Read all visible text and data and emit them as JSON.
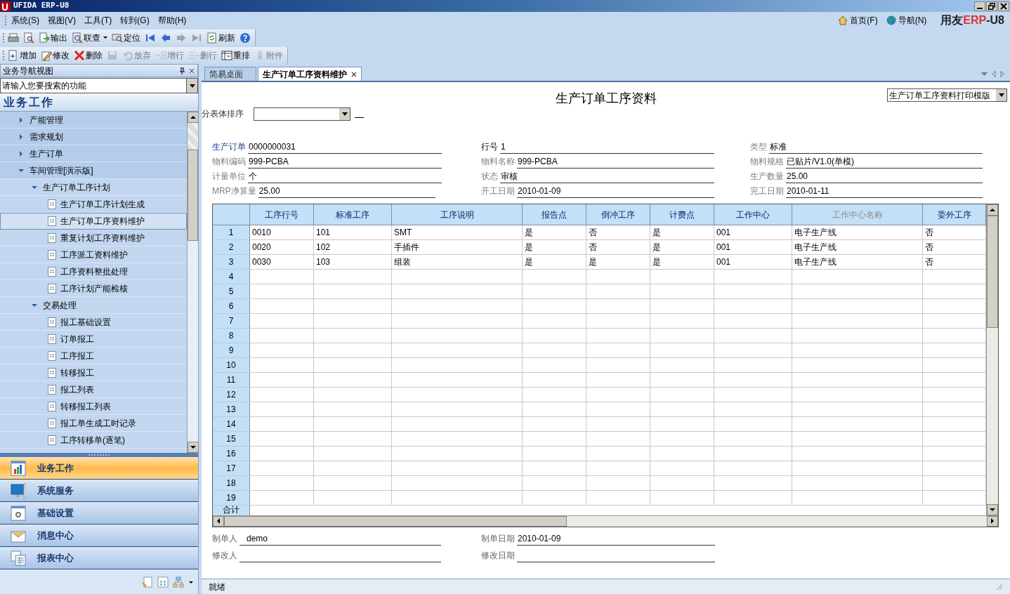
{
  "window": {
    "title": "UFIDA ERP-U8"
  },
  "menu": [
    {
      "label": "系统(S)"
    },
    {
      "label": "视图(V)"
    },
    {
      "label": "工具(T)"
    },
    {
      "label": "转到(G)"
    },
    {
      "label": "帮助(H)"
    }
  ],
  "top_links": [
    {
      "label": "首页(F)"
    },
    {
      "label": "导航(N)"
    }
  ],
  "brand": {
    "name": "用友",
    "product": "ERP",
    "version": "-U8"
  },
  "toolbar_1": [
    {
      "disabled": false
    },
    {
      "disabled": false
    },
    {
      "label": "输出",
      "disabled": false
    },
    {
      "label": "联查",
      "disabled": false,
      "dropdown": true
    },
    {
      "label": "定位",
      "disabled": false
    },
    {
      "disabled": false
    },
    {
      "disabled": false
    },
    {
      "disabled": true
    },
    {
      "disabled": true
    },
    {
      "label": "刷新",
      "disabled": false
    },
    {
      "disabled": false
    }
  ],
  "toolbar_2": [
    {
      "label": "增加",
      "disabled": false
    },
    {
      "label": "修改",
      "disabled": false
    },
    {
      "label": "删除",
      "disabled": false
    },
    {
      "disabled": true
    },
    {
      "label": "放弃",
      "disabled": true
    },
    {
      "label": "增行",
      "disabled": true
    },
    {
      "label": "删行",
      "disabled": true
    },
    {
      "label": "重排",
      "disabled": false
    },
    {
      "label": "附件",
      "disabled": true
    }
  ],
  "sidebar": {
    "title": "业务导航视图",
    "search": {
      "placeholder": "请输入您要搜索的功能"
    },
    "section": "业务工作",
    "tree": [
      {
        "label": "产能管理",
        "expanded": false,
        "selected": false
      },
      {
        "label": "需求规划",
        "expanded": false,
        "selected": false
      },
      {
        "label": "生产订单",
        "expanded": false,
        "selected": false
      },
      {
        "label": "车间管理[演示版]",
        "expanded": true,
        "selected": false,
        "children": [
          {
            "label": "生产订单工序计划",
            "expanded": true,
            "selected": false,
            "children": [
              {
                "label": "生产订单工序计划生成",
                "selected": false
              },
              {
                "label": "生产订单工序资料维护",
                "selected": true
              },
              {
                "label": "重复计划工序资料维护",
                "selected": false
              },
              {
                "label": "工序派工资料维护",
                "selected": false
              },
              {
                "label": "工序资料整批处理",
                "selected": false
              },
              {
                "label": "工序计划产能检核",
                "selected": false
              }
            ]
          },
          {
            "label": "交易处理",
            "expanded": true,
            "selected": false,
            "children": [
              {
                "label": "报工基础设置",
                "selected": false
              },
              {
                "label": "订单报工",
                "selected": false
              },
              {
                "label": "工序报工",
                "selected": false
              },
              {
                "label": "转移报工",
                "selected": false
              },
              {
                "label": "报工列表",
                "selected": false
              },
              {
                "label": "转移报工列表",
                "selected": false
              },
              {
                "label": "报工单生成工时记录",
                "selected": false
              },
              {
                "label": "工序转移单(逐笔)",
                "selected": false
              }
            ]
          }
        ]
      }
    ],
    "nav_buttons": [
      {
        "label": "业务工作",
        "selected": true
      },
      {
        "label": "系统服务",
        "selected": false
      },
      {
        "label": "基础设置",
        "selected": false
      },
      {
        "label": "消息中心",
        "selected": false
      },
      {
        "label": "报表中心",
        "selected": false
      }
    ]
  },
  "tabs": [
    {
      "label": "简易桌面",
      "selected": false
    },
    {
      "label": "生产订单工序资料维护",
      "selected": true
    }
  ],
  "form": {
    "title": "生产订单工序资料",
    "print_template": "生产订单工序资料打印模版",
    "sort_label": "分表体排序",
    "header_fields": [
      {
        "label": "生产订单",
        "value": "0000000031",
        "required": true,
        "readonly": false
      },
      {
        "label": "行号",
        "value": "1",
        "required": false,
        "readonly": false
      },
      {
        "label": "类型",
        "value": "标准",
        "required": false,
        "readonly": true
      },
      {
        "label": "物料编码",
        "value": "999-PCBA",
        "required": false,
        "readonly": true
      },
      {
        "label": "物料名称",
        "value": "999-PCBA",
        "required": false,
        "readonly": true
      },
      {
        "label": "物料规格",
        "value": "已贴片/V1.0(单模)",
        "required": false,
        "readonly": true
      },
      {
        "label": "计量单位",
        "value": "个",
        "required": false,
        "readonly": true
      },
      {
        "label": "状态",
        "value": "审核",
        "required": false,
        "readonly": true
      },
      {
        "label": "生产数量",
        "value": "25.00",
        "required": false,
        "readonly": true
      },
      {
        "label": "MRP净算量",
        "value": "25.00",
        "required": false,
        "readonly": true
      },
      {
        "label": "开工日期",
        "value": "2010-01-09",
        "required": false,
        "readonly": true
      },
      {
        "label": "完工日期",
        "value": "2010-01-11",
        "required": false,
        "readonly": true
      }
    ],
    "table": {
      "columns": [
        {
          "label": "工序行号",
          "disabled": false
        },
        {
          "label": "标准工序",
          "disabled": false
        },
        {
          "label": "工序说明",
          "disabled": false
        },
        {
          "label": "报告点",
          "disabled": false
        },
        {
          "label": "倒冲工序",
          "disabled": false
        },
        {
          "label": "计费点",
          "disabled": false
        },
        {
          "label": "工作中心",
          "disabled": false
        },
        {
          "label": "工作中心名称",
          "disabled": true
        },
        {
          "label": "委外工序",
          "disabled": false
        }
      ],
      "rows": [
        {
          "number": "1",
          "cells": [
            "0010",
            "101",
            "SMT",
            "是",
            "否",
            "是",
            "001",
            "电子生产线",
            "否"
          ]
        },
        {
          "number": "2",
          "cells": [
            "0020",
            "102",
            "手插件",
            "是",
            "否",
            "是",
            "001",
            "电子生产线",
            "否"
          ]
        },
        {
          "number": "3",
          "cells": [
            "0030",
            "103",
            "组装",
            "是",
            "是",
            "是",
            "001",
            "电子生产线",
            "否"
          ]
        },
        {
          "number": "4"
        },
        {
          "number": "5"
        },
        {
          "number": "6"
        },
        {
          "number": "7"
        },
        {
          "number": "8"
        },
        {
          "number": "9"
        },
        {
          "number": "10"
        },
        {
          "number": "11"
        },
        {
          "number": "12"
        },
        {
          "number": "13"
        },
        {
          "number": "14"
        },
        {
          "number": "15"
        },
        {
          "number": "16"
        },
        {
          "number": "17"
        },
        {
          "number": "18"
        },
        {
          "number": "19"
        }
      ],
      "total_label": "合计"
    },
    "footer_fields": [
      {
        "label": "制单人",
        "value": "demo"
      },
      {
        "label": "制单日期",
        "value": "2010-01-09"
      },
      {
        "label": "修改人"
      },
      {
        "label": "修改日期"
      }
    ]
  },
  "status_bar": {
    "text": "就绪"
  }
}
